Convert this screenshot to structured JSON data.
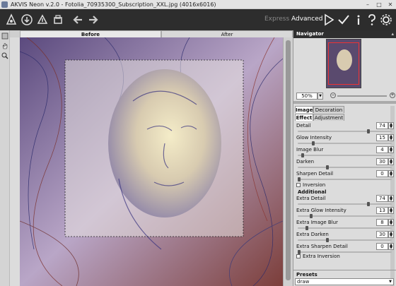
{
  "window": {
    "title": "AKVIS Neon v.2.0 - Fotolia_70935300_Subscription_XXL.jpg (4016x6016)",
    "controls": [
      "–",
      "□",
      "✕"
    ]
  },
  "toolbar": {
    "modes": {
      "express": "Express",
      "advanced": "Advanced"
    },
    "accent": "#2d2d2d"
  },
  "canvas": {
    "tabs": {
      "before": "Before",
      "after": "After"
    }
  },
  "navigator": {
    "title": "Navigator",
    "zoom": "50%"
  },
  "settings": {
    "tabs": {
      "image": "Image",
      "decoration": "Decoration"
    },
    "subtabs": {
      "effect": "Effect",
      "adjustment": "Adjustment"
    },
    "params": [
      {
        "label": "Detail",
        "value": "74",
        "level": 0.74
      },
      {
        "label": "Glow Intensity",
        "value": "15",
        "level": 0.15
      },
      {
        "label": "Image Blur",
        "value": "4",
        "level": 0.04
      },
      {
        "label": "Darken",
        "value": "30",
        "level": 0.3
      },
      {
        "label": "Sharpen Detail",
        "value": "0",
        "level": 0.0
      }
    ],
    "inversion": "Inversion",
    "additional": "Additional",
    "extra_params": [
      {
        "label": "Extra Detail",
        "value": "74",
        "level": 0.74
      },
      {
        "label": "Extra Glow Intensity",
        "value": "13",
        "level": 0.13
      },
      {
        "label": "Extra Image Blur",
        "value": "8",
        "level": 0.08
      },
      {
        "label": "Extra Darken",
        "value": "30",
        "level": 0.3
      },
      {
        "label": "Extra Sharpen Detail",
        "value": "0",
        "level": 0.0
      }
    ],
    "extra_inversion": "Extra Inversion"
  },
  "presets": {
    "title": "Presets",
    "selected": "draw"
  }
}
